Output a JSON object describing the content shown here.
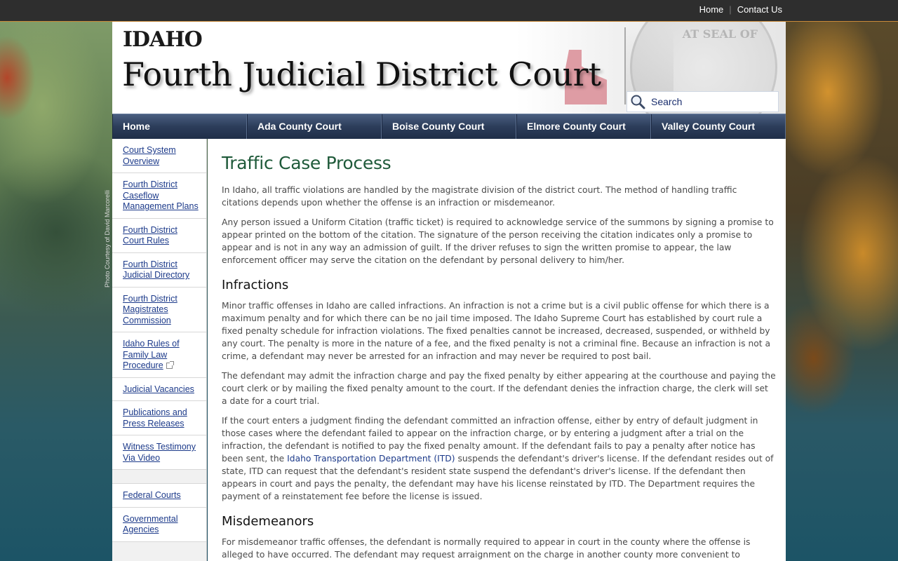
{
  "topbar": {
    "home_label": "Home",
    "contact_label": "Contact Us"
  },
  "header": {
    "state_logo": "IDAHO",
    "site_title": "Fourth Judicial District Court",
    "seal_text": "AT SEAL OF",
    "search_placeholder": "Search"
  },
  "background": {
    "photo_credit": "Photo Courtesy of David Marcorelli"
  },
  "nav": {
    "items": [
      {
        "label": "Home"
      },
      {
        "label": "Ada County Court"
      },
      {
        "label": "Boise County Court"
      },
      {
        "label": "Elmore County Court"
      },
      {
        "label": "Valley County Court"
      }
    ]
  },
  "sidebar": {
    "items": [
      {
        "label": "Court System Overview"
      },
      {
        "label": "Fourth District Caseflow Management Plans"
      },
      {
        "label": "Fourth District Court Rules"
      },
      {
        "label": "Fourth District Judicial Directory"
      },
      {
        "label": "Fourth District Magistrates Commission"
      },
      {
        "label": "Idaho Rules of Family Law Procedure"
      },
      {
        "label": "Judicial Vacancies"
      },
      {
        "label": "Publications and Press Releases"
      },
      {
        "label": "Witness Testimony Via Video"
      },
      {
        "label": "Federal Courts"
      },
      {
        "label": "Governmental Agencies"
      }
    ]
  },
  "main": {
    "title": "Traffic Case Process",
    "intro_1": "In Idaho, all traffic violations are handled by the magistrate division of the district court. The method of handling traffic citations depends upon whether the offense is an infraction or misdemeanor.",
    "intro_2": "Any person issued a Uniform Citation (traffic ticket) is required to acknowledge service of the summons by signing a promise to appear printed on the bottom of the citation. The signature of the person receiving the citation indicates only a promise to appear and is not in any way an admission of guilt. If the driver refuses to sign the written promise to appear, the law enforcement officer may serve the citation on the defendant by personal delivery to him/her.",
    "infractions_heading": "Infractions",
    "infractions_1": "Minor traffic offenses in Idaho are called infractions. An infraction is not a crime but is a civil public offense for which there is a maximum penalty and for which there can be no jail time imposed. The Idaho Supreme Court has established by court rule a fixed penalty schedule for infraction violations. The fixed penalties cannot be increased, decreased, suspended, or withheld by any court. The penalty is more in the nature of a fee, and the fixed penalty is not a criminal fine. Because an infraction is not a crime, a defendant may never be arrested for an infraction and may never be required to post bail.",
    "infractions_2": "The defendant may admit the infraction charge and pay the fixed penalty by either appearing at the courthouse and paying the court clerk or by mailing the fixed penalty amount to the court. If the defendant denies the infraction charge, the clerk will set a date for a court trial.",
    "infractions_3_a": "If the court enters a judgment finding the defendant committed an infraction offense, either by entry of default judgment in those cases where the defendant failed to appear on the infraction charge, or by entering a judgment after a trial on the infraction, the defendant is notified to pay the fixed penalty amount. If the defendant fails to pay a penalty after notice has been sent, the ",
    "infractions_3_link": "Idaho Transportation Department (ITD)",
    "infractions_3_b": " suspends the defendant's driver's license. If the defendant resides out of state, ITD can request that the defendant's resident state suspend the defendant's driver's license. If the defendant then appears in court and pays the penalty, the defendant may have his license reinstated by ITD. The Department requires the payment of a reinstatement fee before the license is issued.",
    "misdemeanors_heading": "Misdemeanors",
    "misdemeanors_1": "For misdemeanor traffic offenses, the defendant is normally required to appear in court in the county where the offense is alleged to have occurred. The defendant may request arraignment on the charge in another county more convenient to him/her. This request is"
  }
}
